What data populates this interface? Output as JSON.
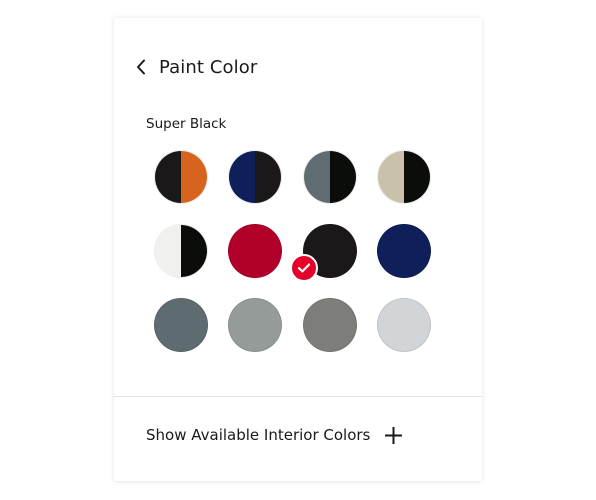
{
  "header": {
    "title": "Paint Color",
    "back_icon": "chevron-left-icon"
  },
  "selected_color": "Super Black",
  "swatches": [
    {
      "id": "black-orange",
      "colors": [
        "#1c1718",
        "#d7641e"
      ],
      "selected": false
    },
    {
      "id": "blue-black",
      "colors": [
        "#0e1f59",
        "#1c1718"
      ],
      "selected": false
    },
    {
      "id": "gray-black",
      "colors": [
        "#5f6d72",
        "#0b0d0a"
      ],
      "selected": false
    },
    {
      "id": "tan-black",
      "colors": [
        "#c9c1aa",
        "#0b0d0a"
      ],
      "selected": false
    },
    {
      "id": "white-black",
      "colors": [
        "#f0f0ee",
        "#0b0d0a"
      ],
      "selected": false
    },
    {
      "id": "red",
      "colors": [
        "#b10029"
      ],
      "selected": false
    },
    {
      "id": "super-black",
      "colors": [
        "#1c1718"
      ],
      "selected": true
    },
    {
      "id": "blue",
      "colors": [
        "#0f1f5a"
      ],
      "selected": false
    },
    {
      "id": "slate-gray",
      "colors": [
        "#5e6b70"
      ],
      "selected": false
    },
    {
      "id": "sage-gray",
      "colors": [
        "#959b98"
      ],
      "selected": false
    },
    {
      "id": "dark-gray",
      "colors": [
        "#7d7e7a"
      ],
      "selected": false
    },
    {
      "id": "light-silver",
      "colors": [
        "#d1d5d8"
      ],
      "selected": false
    }
  ],
  "accent_color": "#e4002b",
  "interior": {
    "label": "Show Available Interior Colors",
    "icon": "plus-icon"
  }
}
